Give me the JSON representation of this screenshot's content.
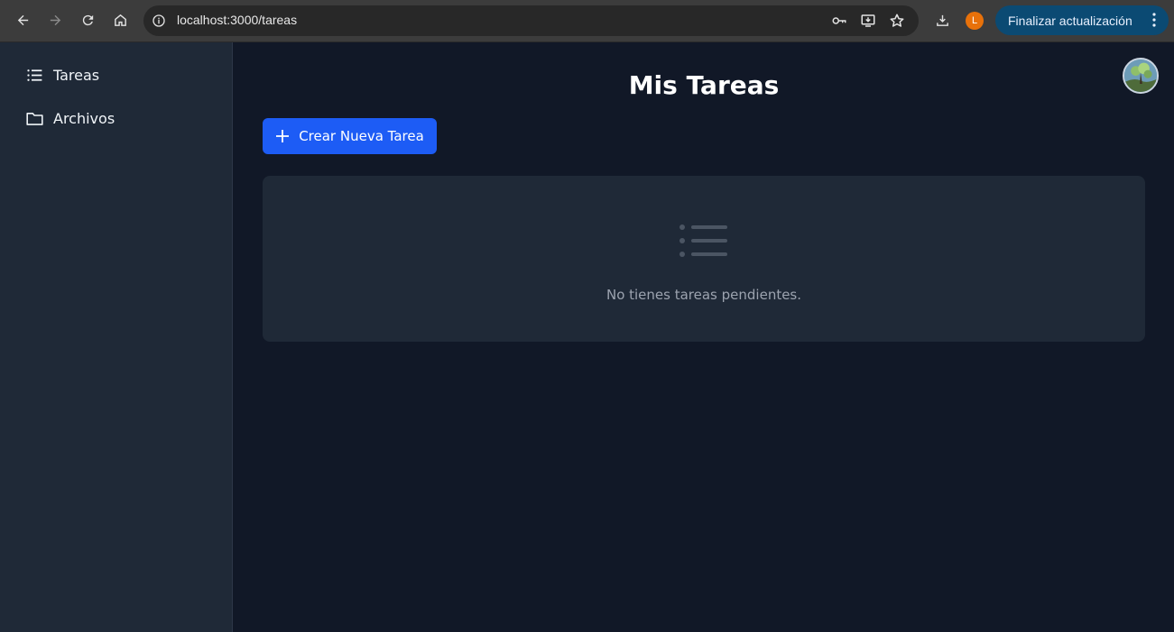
{
  "browser": {
    "url": "localhost:3000/tareas",
    "profile_initial": "L",
    "update_label": "Finalizar actualización",
    "icons": [
      "back-icon",
      "forward-icon",
      "reload-icon",
      "home-icon",
      "info-icon",
      "key-icon",
      "install-icon",
      "star-icon",
      "download-icon",
      "more-icon"
    ]
  },
  "sidebar": {
    "items": [
      {
        "label": "Tareas",
        "icon": "list-icon"
      },
      {
        "label": "Archivos",
        "icon": "folder-icon"
      }
    ]
  },
  "main": {
    "title": "Mis Tareas",
    "create_button": "Crear Nueva Tarea",
    "empty_message": "No tienes tareas pendientes."
  },
  "colors": {
    "background": "#111827",
    "sidebar": "#1f2937",
    "accent": "#1d5cf5",
    "muted_text": "#9ca3af"
  }
}
